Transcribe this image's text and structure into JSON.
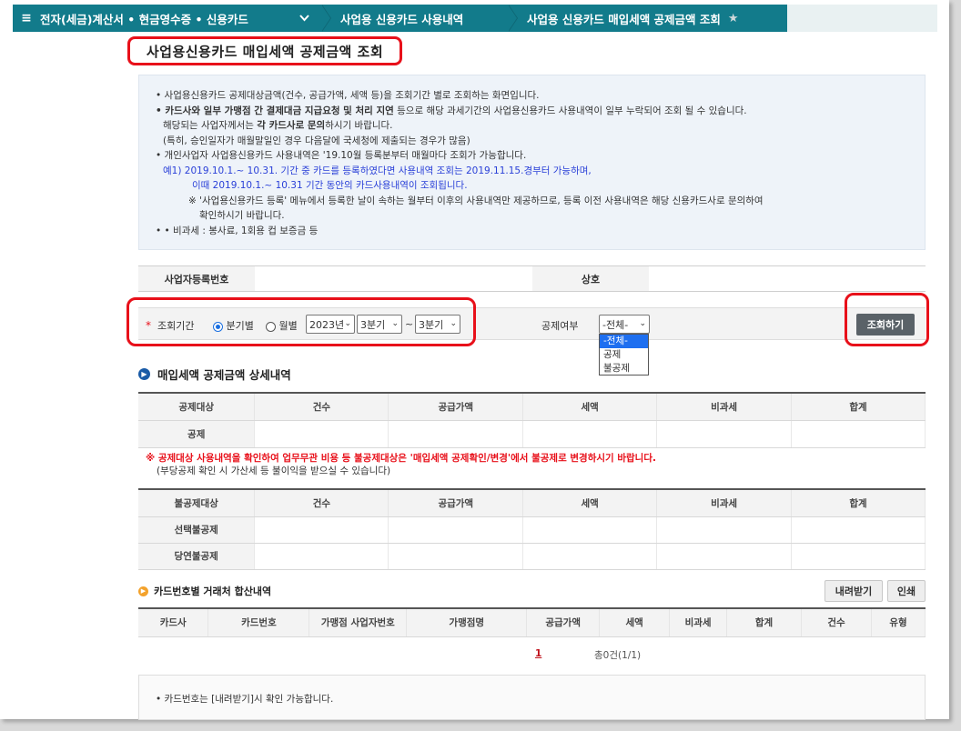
{
  "nav": {
    "menu_icon": "≡",
    "segment1": "전자(세금)계산서 • 현금영수증 • 신용카드",
    "segment2": "사업용 신용카드 사용내역",
    "segment3": "사업용 신용카드 매입세액 공제금액 조회",
    "chevron": "❯"
  },
  "page_title": "사업용신용카드 매입세액 공제금액 조회",
  "notice": {
    "line1": "• 사업용신용카드 공제대상금액(건수, 공급가액, 세액 등)을 조회기간 별로 조회하는 화면입니다.",
    "line2_bold": "• 카드사와 일부 가맹점 간 결제대금 지급요청 및 처리 지연",
    "line2_rest": " 등으로 해당 과세기간의 사업용신용카드 사용내역이 일부 누락되어 조회 될 수 있습니다.",
    "line3_a": "해당되는 사업자께서는 ",
    "line3_bold": "각 카드사로 문의",
    "line3_b": "하시기 바랍니다.",
    "line4": "(특히, 승인일자가 매월말일인 경우 다음달에 국세청에 제출되는 경우가 많음)",
    "line5": "• 개인사업자 사업용신용카드 사용내역은 '19.10월 등록분부터 매월마다 조회가 가능합니다.",
    "line6": "예1) 2019.10.1.~ 10.31. 기간 중 카드를 등록하였다면 사용내역 조회는 2019.11.15.경부터 가능하며,",
    "line7": "이때 2019.10.1.~ 10.31 기간 동안의 카드사용내역이 조회됩니다.",
    "line8": "※ '사업용신용카드 등록' 메뉴에서 등록한 날이 속하는 월부터 이후의 사용내역만 제공하므로, 등록 이전 사용내역은 해당 신용카드사로 문의하여",
    "line9": "확인하시기 바랍니다.",
    "line10": "• • 비과세 : 봉사료, 1회용 컵 보증금 등"
  },
  "info": {
    "business_no_label": "사업자등록번호",
    "company_label": "상호"
  },
  "search": {
    "required_mark": "*",
    "period_label": "조회기간",
    "radio_quarter": "분기별",
    "radio_month": "월별",
    "year": "2023년",
    "from_quarter": "3분기",
    "tilde": "~",
    "to_quarter": "3분기",
    "deduct_label": "공제여부",
    "deduct_value": "-전체-",
    "deduct_options": [
      "-전체-",
      "공제",
      "불공제"
    ],
    "search_button": "조회하기",
    "caret": "⌄"
  },
  "detail": {
    "title": "매입세액 공제금액 상세내역",
    "headers": [
      "공제대상",
      "건수",
      "공급가액",
      "세액",
      "비과세",
      "합계"
    ],
    "rows": [
      "공제"
    ]
  },
  "warning": {
    "line1": "※ 공제대상 사용내역을 확인하여 업무무관 비용 등 불공제대상은 '매입세액 공제확인/변경'에서 불공제로 변경하시기 바랍니다.",
    "line2": "(부당공제 확인 시 가산세 등 불이익을 받으실 수 있습니다)"
  },
  "nondeduct": {
    "headers": [
      "불공제대상",
      "건수",
      "공급가액",
      "세액",
      "비과세",
      "합계"
    ],
    "rows": [
      "선택불공제",
      "당연불공제"
    ]
  },
  "card_summary": {
    "title": "카드번호별 거래처 합산내역",
    "download_button": "내려받기",
    "print_button": "인쇄",
    "headers": [
      "카드사",
      "카드번호",
      "가맹점 사업자번호",
      "가맹점명",
      "공급가액",
      "세액",
      "비과세",
      "합계",
      "건수",
      "유형"
    ]
  },
  "pager": {
    "page": "1",
    "total": "총0건(1/1)"
  },
  "footnote": "• 카드번호는 [내려받기]시 확인 가능합니다.",
  "colors": {
    "nav_bg": "#127b8b",
    "highlight_red": "#e8101a",
    "notice_blue": "#2a40d8",
    "button_dark": "#5a6268"
  }
}
